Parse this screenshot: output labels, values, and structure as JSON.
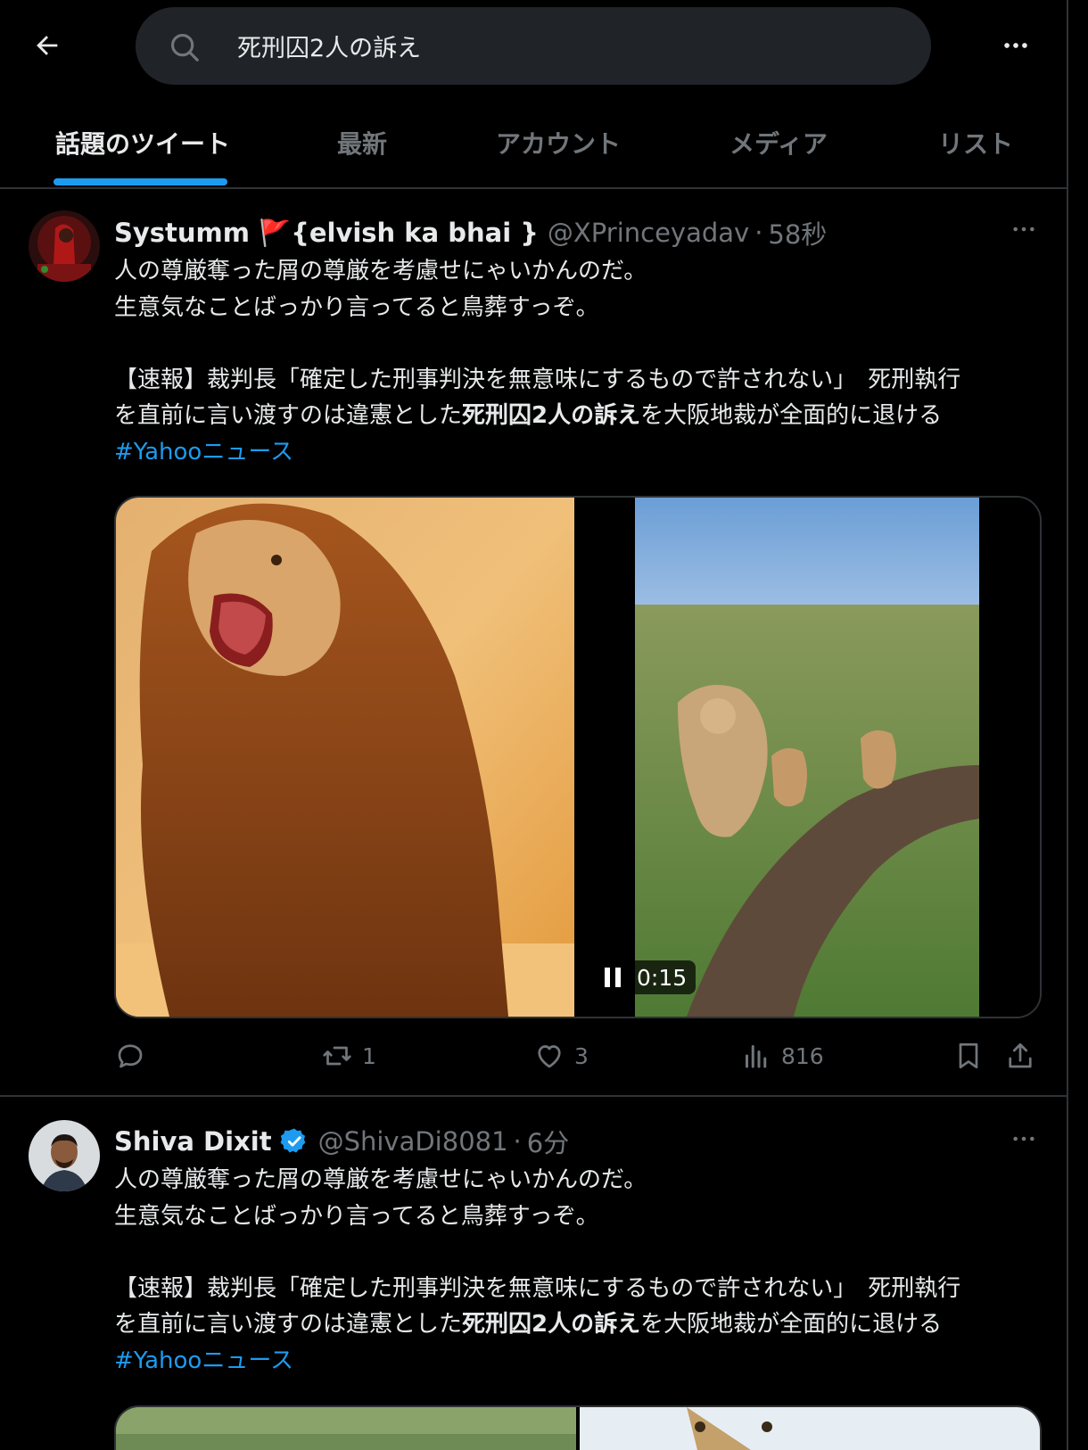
{
  "search": {
    "query": "死刑囚2人の訴え"
  },
  "tabs": [
    "話題のツイート",
    "最新",
    "アカウント",
    "メディア",
    "リスト"
  ],
  "tweets": [
    {
      "name": "Systumm 🚩{elvish ka bhai }",
      "handle": "@XPrinceyadav",
      "time": "58秒",
      "line1": "人の尊厳奪った屑の尊厳を考慮せにゃいかんのだ。",
      "line2": "生意気なことばっかり言ってると鳥葬すっぞ。",
      "line3": "【速報】裁判長「確定した刑事判決を無意味にするもので許されない」　死刑執行",
      "line4a": "を直前に言い渡すのは違憲とした",
      "line4b": "死刑囚2人の訴え",
      "line4c": "を大阪地裁が全面的に退ける",
      "hashtag": "#Yahooニュース",
      "video_time": "0:15",
      "replies": "",
      "retweets": "1",
      "likes": "3",
      "views": "816"
    },
    {
      "name": "Shiva Dixit",
      "handle": "@ShivaDi8081",
      "time": "6分",
      "line1": "人の尊厳奪った屑の尊厳を考慮せにゃいかんのだ。",
      "line2": "生意気なことばっかり言ってると鳥葬すっぞ。",
      "line3": "【速報】裁判長「確定した刑事判決を無意味にするもので許されない」　死刑執行",
      "line4a": "を直前に言い渡すのは違憲とした",
      "line4b": "死刑囚2人の訴え",
      "line4c": "を大阪地裁が全面的に退ける",
      "hashtag": "#Yahooニュース"
    }
  ],
  "colors": {
    "background": "#000000",
    "text": "#e7e9ea",
    "muted": "#71767b",
    "accent": "#1d9bf0",
    "verified": "#1d9bf0",
    "border": "#2f3336"
  }
}
